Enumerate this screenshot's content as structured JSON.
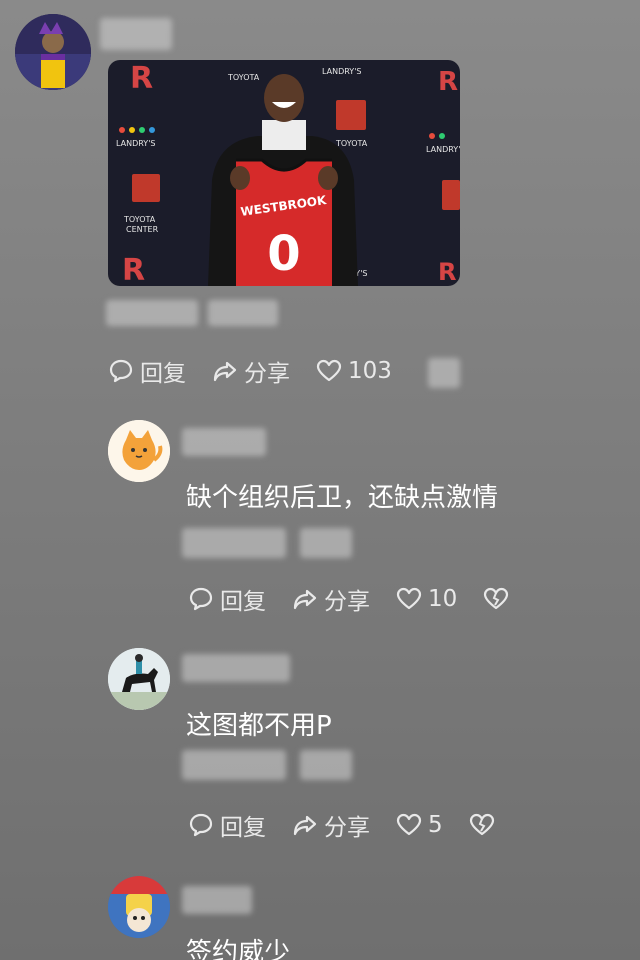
{
  "post": {
    "jersey_name": "WESTBROOK",
    "jersey_number": "0",
    "backdrop_brands": [
      "TOYOTA",
      "CENTER",
      "LANDRY'S"
    ],
    "actions": {
      "reply": "回复",
      "share": "分享",
      "likes": "103"
    }
  },
  "comments": [
    {
      "text": "缺个组织后卫，还缺点激情",
      "reply": "回复",
      "share": "分享",
      "likes": "10"
    },
    {
      "text": "这图都不用P",
      "reply": "回复",
      "share": "分享",
      "likes": "5"
    },
    {
      "text": "签约威少"
    }
  ],
  "colors": {
    "background": "#808080",
    "text": "#ffffff",
    "action_text": "#e9e9e9",
    "jersey_red": "#d62a2a"
  }
}
